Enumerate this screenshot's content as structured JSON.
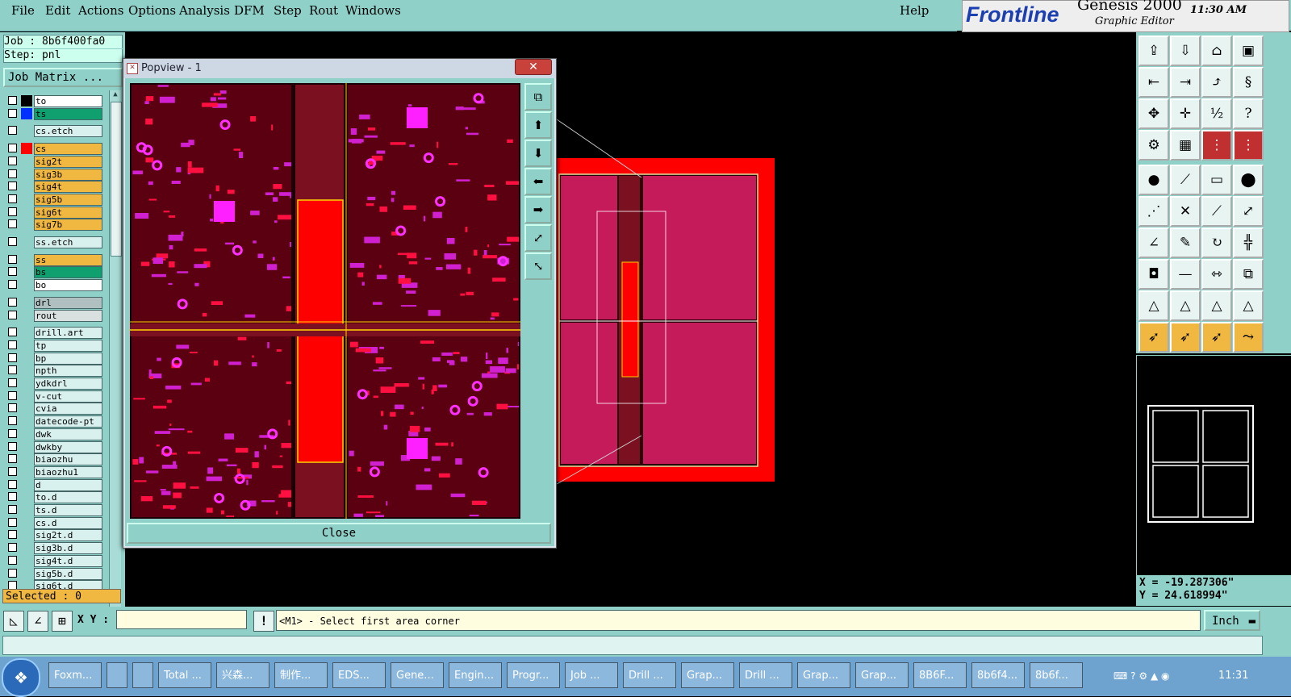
{
  "menu": [
    "File",
    "Edit",
    "Actions",
    "Options",
    "Analysis",
    "DFM",
    "Step",
    "Rout",
    "Windows"
  ],
  "help_label": "Help",
  "brand": {
    "logo": "Frontline",
    "product": "Genesis 2000",
    "subtitle": "Graphic Editor",
    "time": "11:30 AM"
  },
  "job": {
    "job_line": "Job : 8b6f400fa0",
    "step_line": "Step: pnl",
    "matrix_button": "Job Matrix ..."
  },
  "layers": [
    {
      "name": "to",
      "color": "#ffffff",
      "swatch": "#000000"
    },
    {
      "name": "ts",
      "color": "#10a070",
      "swatch": "#0030ff"
    },
    {
      "name": "cs.etch",
      "color": "#d8f0ee",
      "swatch": ""
    },
    {
      "name": "cs",
      "color": "#f0b840",
      "swatch": "#ff0000"
    },
    {
      "name": "sig2t",
      "color": "#f0b840",
      "swatch": ""
    },
    {
      "name": "sig3b",
      "color": "#f0b840",
      "swatch": ""
    },
    {
      "name": "sig4t",
      "color": "#f0b840",
      "swatch": ""
    },
    {
      "name": "sig5b",
      "color": "#f0b840",
      "swatch": ""
    },
    {
      "name": "sig6t",
      "color": "#f0b840",
      "swatch": ""
    },
    {
      "name": "sig7b",
      "color": "#f0b840",
      "swatch": ""
    },
    {
      "name": "ss.etch",
      "color": "#d8f0ee",
      "swatch": ""
    },
    {
      "name": "ss",
      "color": "#f0b840",
      "swatch": ""
    },
    {
      "name": "bs",
      "color": "#10a070",
      "swatch": ""
    },
    {
      "name": "bo",
      "color": "#ffffff",
      "swatch": ""
    },
    {
      "name": "drl",
      "color": "#b0c0c0",
      "swatch": ""
    },
    {
      "name": "rout",
      "color": "#d8e0e0",
      "swatch": ""
    },
    {
      "name": "drill.art",
      "color": "#d8f0ee",
      "swatch": ""
    },
    {
      "name": "tp",
      "color": "#d8f0ee",
      "swatch": ""
    },
    {
      "name": "bp",
      "color": "#d8f0ee",
      "swatch": ""
    },
    {
      "name": "npth",
      "color": "#d8f0ee",
      "swatch": ""
    },
    {
      "name": "ydkdrl",
      "color": "#d8f0ee",
      "swatch": ""
    },
    {
      "name": "v-cut",
      "color": "#d8f0ee",
      "swatch": ""
    },
    {
      "name": "cvia",
      "color": "#d8f0ee",
      "swatch": ""
    },
    {
      "name": "datecode-pt",
      "color": "#d8f0ee",
      "swatch": ""
    },
    {
      "name": "dwk",
      "color": "#d8f0ee",
      "swatch": ""
    },
    {
      "name": "dwkby",
      "color": "#d8f0ee",
      "swatch": ""
    },
    {
      "name": "biaozhu",
      "color": "#d8f0ee",
      "swatch": ""
    },
    {
      "name": "biaozhu1",
      "color": "#d8f0ee",
      "swatch": ""
    },
    {
      "name": "d",
      "color": "#d8f0ee",
      "swatch": ""
    },
    {
      "name": "to.d",
      "color": "#d8f0ee",
      "swatch": ""
    },
    {
      "name": "ts.d",
      "color": "#d8f0ee",
      "swatch": ""
    },
    {
      "name": "cs.d",
      "color": "#d8f0ee",
      "swatch": ""
    },
    {
      "name": "sig2t.d",
      "color": "#d8f0ee",
      "swatch": ""
    },
    {
      "name": "sig3b.d",
      "color": "#d8f0ee",
      "swatch": ""
    },
    {
      "name": "sig4t.d",
      "color": "#d8f0ee",
      "swatch": ""
    },
    {
      "name": "sig5b.d",
      "color": "#d8f0ee",
      "swatch": ""
    },
    {
      "name": "sig6t.d",
      "color": "#d8f0ee",
      "swatch": ""
    }
  ],
  "selected_label": "Selected : 0",
  "popview": {
    "title": "Popview - 1",
    "close_label": "Close"
  },
  "coords": {
    "x": "X = -19.287306\"",
    "y": "Y = 24.618994\""
  },
  "cmd": {
    "xy_label": "X Y :",
    "xy_value": "",
    "prompt": "<M1> - Select first area corner",
    "units": "Inch"
  },
  "taskbar": {
    "items": [
      "Foxm...",
      "",
      "",
      "Total ...",
      "兴森...",
      "制作...",
      "EDS...",
      "Gene...",
      "Engin...",
      "Progr...",
      "Job ...",
      "Drill ...",
      "Grap...",
      "Drill ...",
      "Grap...",
      "Grap...",
      "8B6F...",
      "8b6f4...",
      "8b6f..."
    ],
    "clock": "11:31"
  }
}
